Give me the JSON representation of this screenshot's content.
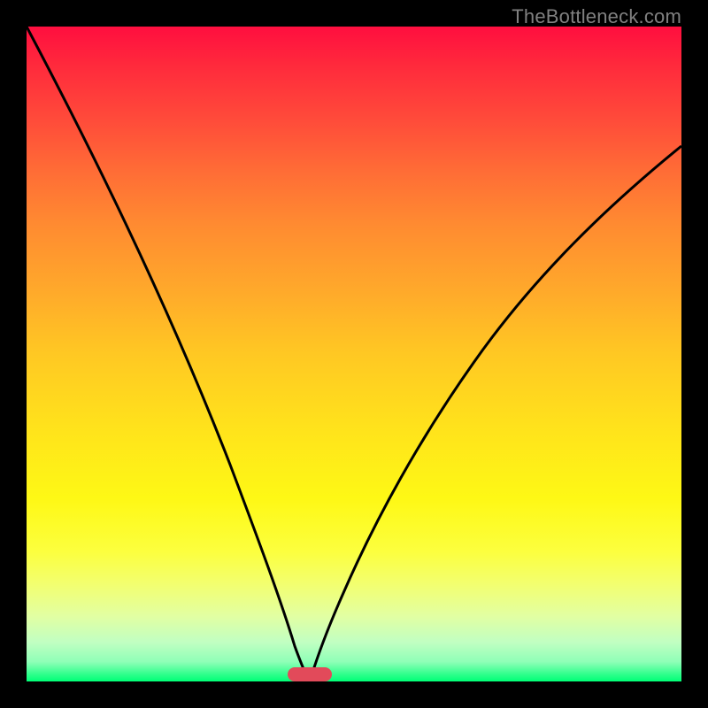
{
  "watermark": "TheBottleneck.com",
  "chart_data": {
    "type": "line",
    "title": "",
    "xlabel": "",
    "ylabel": "",
    "xlim": [
      0,
      100
    ],
    "ylim": [
      0,
      100
    ],
    "grid": false,
    "legend": false,
    "background_gradient": {
      "direction": "vertical",
      "stops": [
        {
          "pos": 0.0,
          "color": "#ff0e3f"
        },
        {
          "pos": 0.3,
          "color": "#ff8a31"
        },
        {
          "pos": 0.62,
          "color": "#ffe41b"
        },
        {
          "pos": 0.9,
          "color": "#e2ffa2"
        },
        {
          "pos": 1.0,
          "color": "#00ff76"
        }
      ]
    },
    "series": [
      {
        "name": "left-curve",
        "x": [
          0.0,
          4,
          8,
          12,
          16,
          20,
          24,
          28,
          32,
          36,
          38,
          40,
          41,
          42,
          43
        ],
        "y": [
          100,
          92,
          84,
          75,
          67,
          58,
          49,
          41,
          32,
          22,
          16,
          10,
          7,
          3,
          0
        ]
      },
      {
        "name": "right-curve",
        "x": [
          43,
          45,
          47,
          50,
          53,
          57,
          61,
          66,
          72,
          78,
          85,
          92,
          100
        ],
        "y": [
          0,
          5,
          10,
          18,
          25,
          33,
          40,
          48,
          56,
          63,
          70,
          76,
          82
        ]
      }
    ],
    "marker": {
      "name": "bottleneck-marker",
      "x_range": [
        40,
        47
      ],
      "y": 0,
      "color": "#e24a5a"
    }
  }
}
